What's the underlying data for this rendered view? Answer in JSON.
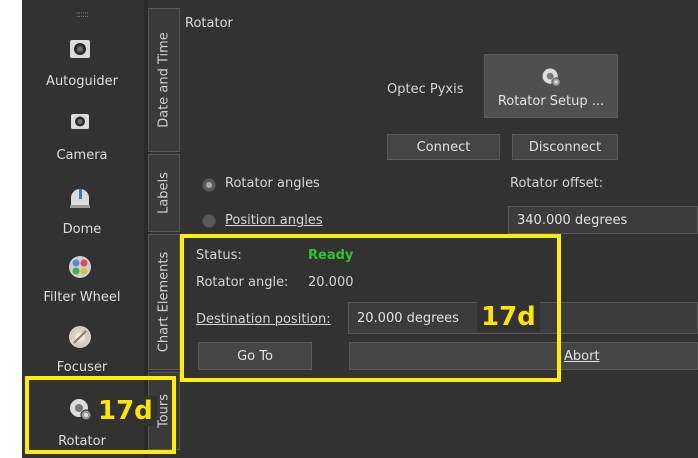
{
  "rail": {
    "items": [
      {
        "label": "Autoguider",
        "icon": "autoguider-icon"
      },
      {
        "label": "Camera",
        "icon": "camera-icon"
      },
      {
        "label": "Dome",
        "icon": "dome-icon"
      },
      {
        "label": "Filter Wheel",
        "icon": "filter-wheel-icon"
      },
      {
        "label": "Focuser",
        "icon": "focuser-icon"
      },
      {
        "label": "Rotator",
        "icon": "rotator-icon"
      }
    ]
  },
  "tabs": [
    {
      "label": "Date and Time"
    },
    {
      "label": "Labels"
    },
    {
      "label": "Chart Elements"
    },
    {
      "label": "Tours"
    }
  ],
  "panel": {
    "title": "Rotator",
    "device_name": "Optec Pyxis",
    "setup_button": "Rotator Setup ...",
    "connect_button": "Connect",
    "disconnect_button": "Disconnect",
    "radio_rotator": "Rotator angles",
    "radio_position": "Position angles",
    "offset_label": "Rotator offset:",
    "offset_value": "340.000 degrees",
    "status_label": "Status:",
    "status_value": "Ready",
    "angle_label": "Rotator angle:",
    "angle_value": "20.000",
    "dest_label": "Destination position:",
    "dest_value": "20.000 degrees",
    "goto_button": "Go To",
    "abort_button": "Abort"
  },
  "annotations": {
    "label_panel": "17d",
    "label_rail": "17d"
  },
  "colors": {
    "highlight": "#ffee00",
    "ready": "#2fc42f",
    "background": "#323232"
  }
}
